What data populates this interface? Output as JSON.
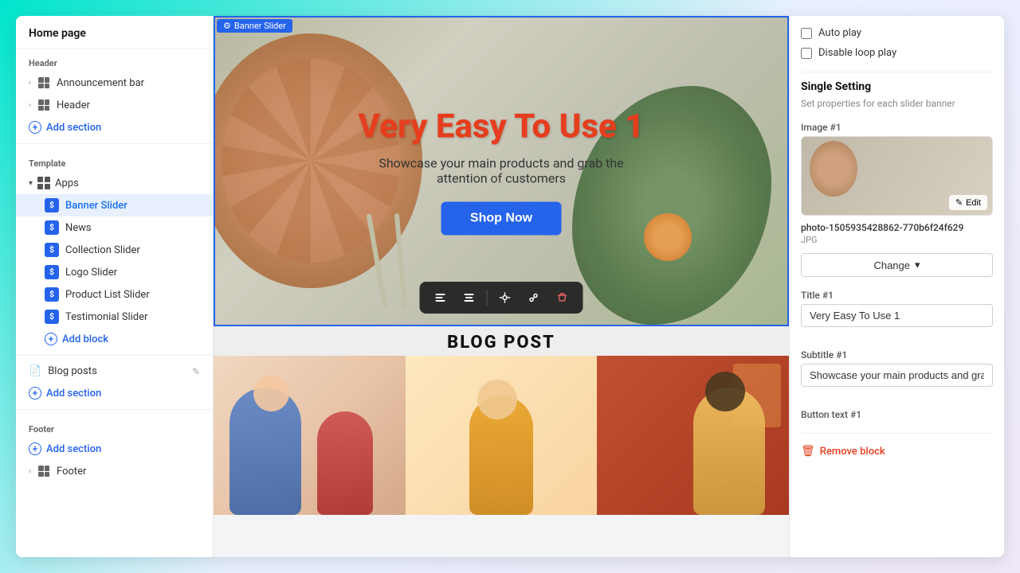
{
  "sidebar": {
    "home_label": "Home page",
    "header_section": "Header",
    "announcement_bar": "Announcement bar",
    "header_item": "Header",
    "add_section_1": "Add section",
    "template_section": "Template",
    "apps_label": "Apps",
    "blocks": [
      {
        "label": "Banner Slider",
        "active": true
      },
      {
        "label": "News"
      },
      {
        "label": "Collection Slider"
      },
      {
        "label": "Logo Slider"
      },
      {
        "label": "Product List Slider"
      },
      {
        "label": "Testimonial Slider"
      }
    ],
    "add_block": "Add block",
    "blog_posts": "Blog posts",
    "add_section_2": "Add section",
    "footer_section": "Footer",
    "add_section_3": "Add section",
    "footer_item": "Footer"
  },
  "banner": {
    "label": "Banner Slider",
    "title": "Very Easy To Use 1",
    "subtitle": "Showcase your main products and grab the attention of customers",
    "shop_now": "Shop Now"
  },
  "blog_section": {
    "header": "BLOG POST"
  },
  "toolbar": {
    "icons": [
      "≡",
      "≡",
      "⊙",
      "⊘",
      "🗑"
    ]
  },
  "right_panel": {
    "auto_play": "Auto play",
    "disable_loop": "Disable loop play",
    "single_setting_title": "Single Setting",
    "single_setting_sub": "Set properties for each slider banner",
    "image_label": "Image #1",
    "image_filename": "photo-1505935428862-770b6f24f629",
    "image_ext": "JPG",
    "change_btn": "Change",
    "edit_btn": "Edit",
    "title_label": "Title #1",
    "title_value": "Very Easy To Use 1",
    "subtitle_label": "Subtitle #1",
    "subtitle_value": "Showcase your main products and grab",
    "button_text_label": "Button text #1",
    "remove_block": "Remove block"
  }
}
